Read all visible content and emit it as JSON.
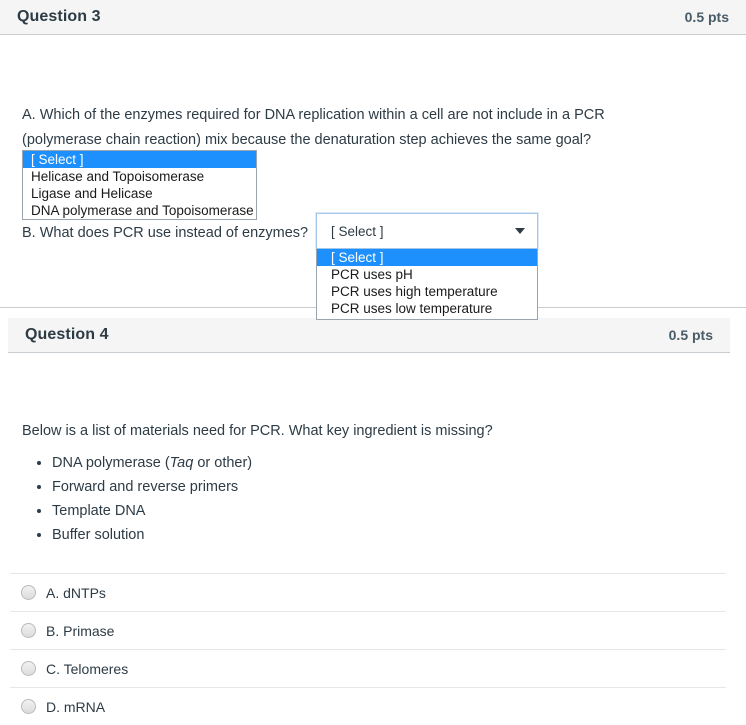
{
  "question3": {
    "header": {
      "title": "Question 3",
      "points": "0.5 pts"
    },
    "part_a": {
      "text": "A. Which of the enzymes required for DNA replication within a cell are not include in a PCR (polymerase chain reaction) mix because the denaturation step achieves the same goal?",
      "dropdown": {
        "selected": "[ Select ]",
        "options": [
          "[ Select ]",
          "Helicase and Topoisomerase",
          "Ligase and Helicase",
          "DNA polymerase and Topoisomerase"
        ]
      }
    },
    "part_b": {
      "text": "B. What does PCR use instead of enzymes?",
      "dropdown": {
        "selected": "[ Select ]",
        "options": [
          "[ Select ]",
          "PCR uses pH",
          "PCR uses high temperature",
          "PCR uses low temperature"
        ]
      }
    }
  },
  "question4": {
    "header": {
      "title": "Question 4",
      "points": "0.5 pts"
    },
    "prompt": "Below is a list of materials need for PCR.  What key ingredient is missing?",
    "materials": [
      {
        "pre": "DNA polymerase (",
        "italic": "Taq",
        "post": " or other)"
      },
      {
        "pre": "Forward and reverse primers",
        "italic": "",
        "post": ""
      },
      {
        "pre": "Template DNA",
        "italic": "",
        "post": ""
      },
      {
        "pre": "Buffer solution",
        "italic": "",
        "post": ""
      }
    ],
    "answers": [
      "A. dNTPs",
      "B. Primase",
      "C. Telomeres",
      "D. mRNA"
    ]
  },
  "colors": {
    "highlight_blue": "#1e90fe",
    "header_bg": "#f5f5f5",
    "border_gray": "#c7cdd1",
    "text": "#2d3b45"
  }
}
